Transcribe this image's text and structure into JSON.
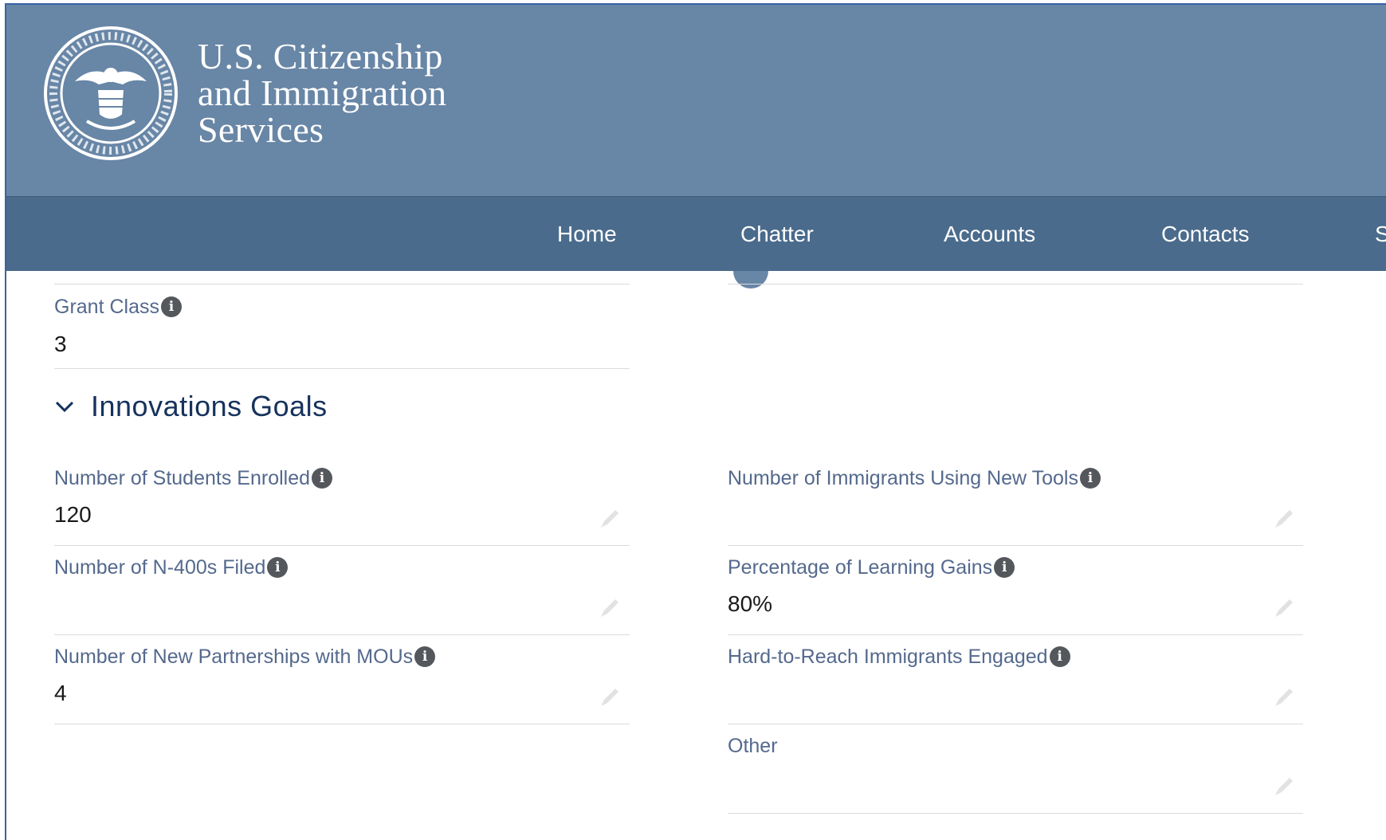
{
  "brand": {
    "line1": "U.S. Citizenship",
    "line2": "and Immigration",
    "line3": "Services",
    "seal_icon": "dhs-seal-icon"
  },
  "nav": {
    "items": [
      "Home",
      "Chatter",
      "Accounts",
      "Contacts",
      "S"
    ]
  },
  "fields": {
    "grant_class": {
      "label": "Grant Class",
      "value": "3"
    },
    "section_title": "Innovations Goals",
    "students_enrolled": {
      "label": "Number of Students Enrolled",
      "value": "120"
    },
    "immigrants_new_tools": {
      "label": "Number of Immigrants Using New Tools",
      "value": ""
    },
    "n400_filed": {
      "label": "Number of N-400s Filed",
      "value": ""
    },
    "learning_gains": {
      "label": "Percentage of Learning Gains",
      "value": "80%"
    },
    "partnerships_mous": {
      "label": "Number of New Partnerships with MOUs",
      "value": "4"
    },
    "hard_to_reach": {
      "label": "Hard-to-Reach Immigrants Engaged",
      "value": ""
    },
    "other": {
      "label": "Other",
      "value": ""
    }
  },
  "icons": {
    "info": "info-icon",
    "edit": "pencil-icon",
    "chevron": "chevron-down-icon"
  },
  "colors": {
    "banner": "#6886a6",
    "nav": "#4a6b8c",
    "label": "#54698d",
    "info_badge": "#54575b"
  }
}
